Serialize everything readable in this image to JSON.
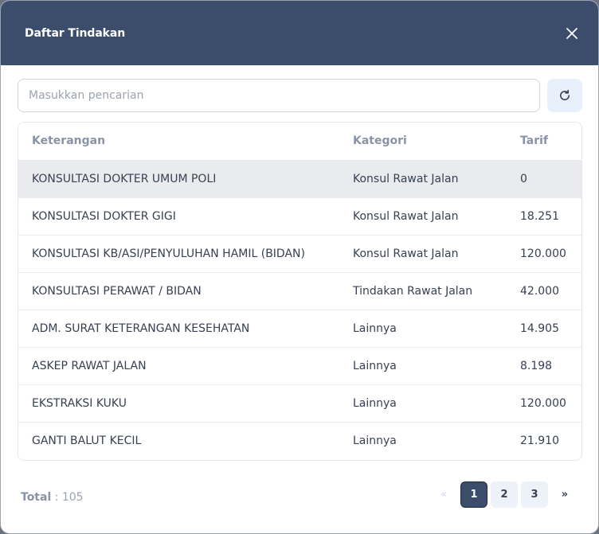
{
  "modal": {
    "title": "Daftar Tindakan"
  },
  "search": {
    "placeholder": "Masukkan pencarian",
    "value": ""
  },
  "table": {
    "headers": [
      "Keterangan",
      "Kategori",
      "Tarif"
    ],
    "rows": [
      {
        "keterangan": "KONSULTASI DOKTER UMUM POLI",
        "kategori": "Konsul Rawat Jalan",
        "tarif": "0"
      },
      {
        "keterangan": "KONSULTASI DOKTER GIGI",
        "kategori": "Konsul Rawat Jalan",
        "tarif": "18.251"
      },
      {
        "keterangan": "KONSULTASI KB/ASI/PENYULUHAN HAMIL (BIDAN)",
        "kategori": "Konsul Rawat Jalan",
        "tarif": "120.000"
      },
      {
        "keterangan": "KONSULTASI PERAWAT / BIDAN",
        "kategori": "Tindakan Rawat Jalan",
        "tarif": "42.000"
      },
      {
        "keterangan": "ADM. SURAT KETERANGAN KESEHATAN",
        "kategori": "Lainnya",
        "tarif": "14.905"
      },
      {
        "keterangan": "ASKEP RAWAT JALAN",
        "kategori": "Lainnya",
        "tarif": "8.198"
      },
      {
        "keterangan": "EKSTRAKSI KUKU",
        "kategori": "Lainnya",
        "tarif": "120.000"
      },
      {
        "keterangan": "GANTI BALUT KECIL",
        "kategori": "Lainnya",
        "tarif": "21.910"
      }
    ]
  },
  "footer": {
    "total_label": "Total",
    "total_value": ": 105"
  },
  "pagination": {
    "prev": "«",
    "pages": [
      "1",
      "2",
      "3"
    ],
    "next": "»"
  },
  "colors": {
    "header_bg": "#3b4d6b",
    "active_row_bg": "#e9ebef",
    "refresh_bg": "#e8f0fb"
  },
  "icons": {
    "close": "close-icon",
    "refresh": "refresh-icon"
  }
}
